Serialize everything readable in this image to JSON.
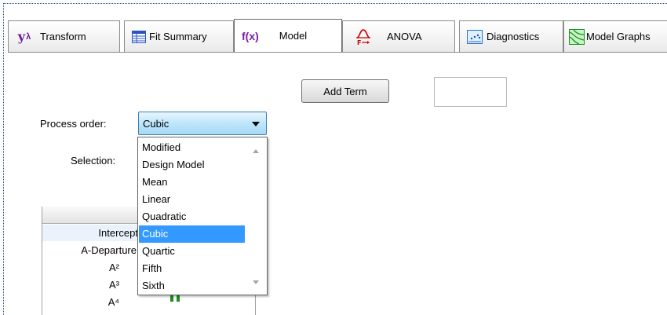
{
  "tabs": [
    {
      "label": "Transform",
      "icon": "y-lambda-icon",
      "active": false
    },
    {
      "label": "Fit Summary",
      "icon": "table-grid-icon",
      "active": false
    },
    {
      "label": "Model",
      "icon": "fx-icon",
      "active": true
    },
    {
      "label": "ANOVA",
      "icon": "f-distribution-icon",
      "active": false
    },
    {
      "label": "Diagnostics",
      "icon": "scatter-plot-icon",
      "active": false
    },
    {
      "label": "Model Graphs",
      "icon": "contour-graph-icon",
      "active": false
    }
  ],
  "icons": {
    "transform_text": "yλ",
    "model_text": "f(x)"
  },
  "add_term": {
    "label": "Add Term",
    "value": ""
  },
  "process_order": {
    "label": "Process order:",
    "value": "Cubic"
  },
  "selection": {
    "label": "Selection:"
  },
  "dropdown": {
    "options": [
      "Modified",
      "Design Model",
      "Mean",
      "Linear",
      "Quadratic",
      "Cubic",
      "Quartic",
      "Fifth",
      "Sixth"
    ],
    "selected": "Cubic"
  },
  "terms": [
    "Intercept",
    "A-Departure",
    "A²",
    "A³",
    "A⁴"
  ],
  "colors": {
    "accent": "#3399ff",
    "model_icon": "#7a1fa2",
    "select_fill": "#bde6fd",
    "grid_mark": "#1d8f1d"
  }
}
